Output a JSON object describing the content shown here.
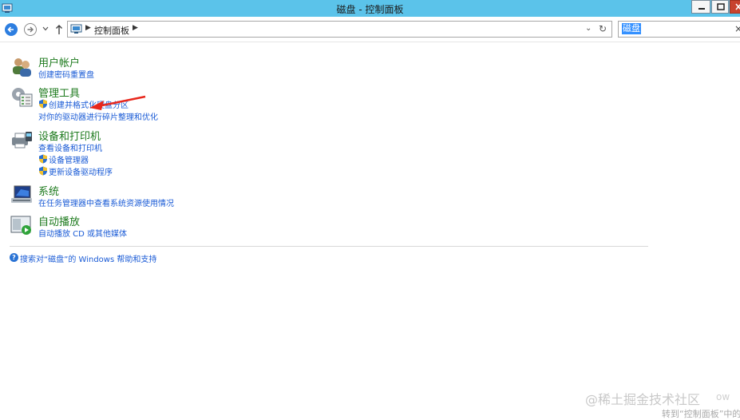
{
  "window": {
    "title": "磁盘 - 控制面板"
  },
  "address": {
    "crumb": "控制面板",
    "search_value": "磁盘"
  },
  "categories": [
    {
      "title": "用户帐户",
      "icon": "users-icon",
      "links": [
        {
          "text": "创建密码重置盘",
          "shield": false
        }
      ]
    },
    {
      "title": "管理工具",
      "icon": "admin-tools-icon",
      "links": [
        {
          "text": "创建并格式化硬盘分区",
          "shield": true
        },
        {
          "text": "对你的驱动器进行碎片整理和优化",
          "shield": false
        }
      ]
    },
    {
      "title": "设备和打印机",
      "icon": "printer-icon",
      "links": [
        {
          "text": "查看设备和打印机",
          "shield": false
        },
        {
          "text": "设备管理器",
          "shield": true
        },
        {
          "text": "更新设备驱动程序",
          "shield": true
        }
      ]
    },
    {
      "title": "系统",
      "icon": "computer-icon",
      "links": [
        {
          "text": "在任务管理器中查看系统资源使用情况",
          "shield": false
        }
      ]
    },
    {
      "title": "自动播放",
      "icon": "autoplay-icon",
      "links": [
        {
          "text": "自动播放 CD 或其他媒体",
          "shield": false
        }
      ]
    }
  ],
  "help_link": "搜索对“磁盘”的 Windows 帮助和支持",
  "watermark": "@稀土掘金技术社区",
  "watermark_partial": "ow",
  "footer_tip": "转到“控制面板”中的",
  "colors": {
    "titlebar": "#5bc3ea",
    "category_title": "#1d7a1d",
    "link": "#1a5bd6",
    "arrow": "#e8271c"
  }
}
